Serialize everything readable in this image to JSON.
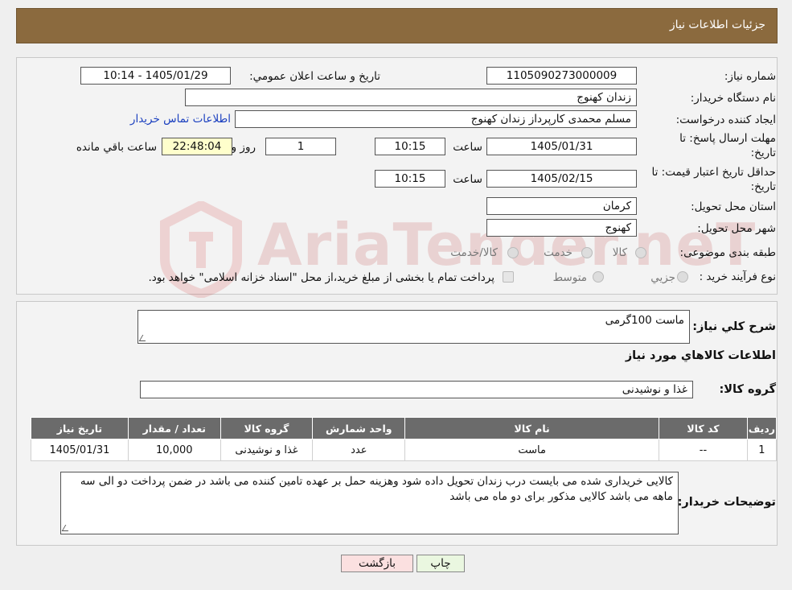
{
  "header": {
    "title": "جزئيات اطلاعات نياز"
  },
  "form": {
    "need_number_label": "شماره نياز:",
    "need_number": "1105090273000009",
    "announce_label": "تاريخ و ساعت اعلان عمومي:",
    "announce_value": "1405/01/29 - 10:14",
    "buyer_org_label": "نام دستگاه خريدار:",
    "buyer_org": "زندان کهنوج",
    "creator_label": "ايجاد کننده درخواست:",
    "creator": "مسلم محمدی کارپرداز زندان کهنوج",
    "contact_link": "اطلاعات تماس خريدار",
    "deadline_label_1": "مهلت ارسال پاسخ: تا",
    "deadline_label_2": "تاريخ:",
    "deadline_date": "1405/01/31",
    "time_label": "ساعت",
    "deadline_time": "10:15",
    "days": "1",
    "days_label": "روز و",
    "remaining": "22:48:04",
    "remaining_label": "ساعت باقي مانده",
    "validity_label_1": "حداقل تاريخ اعتبار قيمت: تا",
    "validity_label_2": "تاريخ:",
    "validity_date": "1405/02/15",
    "validity_time": "10:15",
    "province_label": "استان محل تحويل:",
    "province": "کرمان",
    "city_label": "شهر محل تحويل:",
    "city": "کهنوج",
    "category_label": "طبقه بندی موضوعی:",
    "category_options": [
      "کالا",
      "خدمت",
      "کالا/خدمت"
    ],
    "process_label": "نوع فرآيند خريد :",
    "process_options": [
      "جزيي",
      "متوسط"
    ],
    "payment_note": "پرداخت تمام يا بخشی از مبلغ خريد،از محل \"اسناد خزانه اسلامی\" خواهد بود."
  },
  "details": {
    "summary_label": "شرح کلي نياز:",
    "summary": "ماست 100گرمی",
    "goods_info_title": "اطلاعات کالاهاي مورد نياز",
    "group_label": "گروه کالا:",
    "group": "غذا و نوشيدنی",
    "table": {
      "headers": [
        "رديف",
        "کد کالا",
        "نام کالا",
        "واحد شمارش",
        "گروه کالا",
        "تعداد / مقدار",
        "تاريخ نياز"
      ],
      "rows": [
        [
          "1",
          "--",
          "ماست",
          "عدد",
          "غذا و نوشيدنی",
          "10,000",
          "1405/01/31"
        ]
      ]
    },
    "buyer_notes_label": "توضيحات خريدار:",
    "buyer_notes": "کالایی خریداری شده می بایست درب زندان تحویل داده شود وهزینه حمل بر عهده تامین کننده  می باشد در ضمن پرداخت دو الی سه ماهه می باشد کالایی مذکور برای دو ماه می باشد"
  },
  "buttons": {
    "print": "چاپ",
    "back": "بازگشت"
  },
  "watermark": {
    "brand": "AriaTender.neT"
  },
  "colors": {
    "header": "#8b6a3e",
    "remaining_bg": "#ffffcc",
    "link": "#1a3fbf",
    "table_header": "#6b6b6b",
    "print_bg": "#eaf7e0",
    "back_bg": "#fbe0e0"
  }
}
